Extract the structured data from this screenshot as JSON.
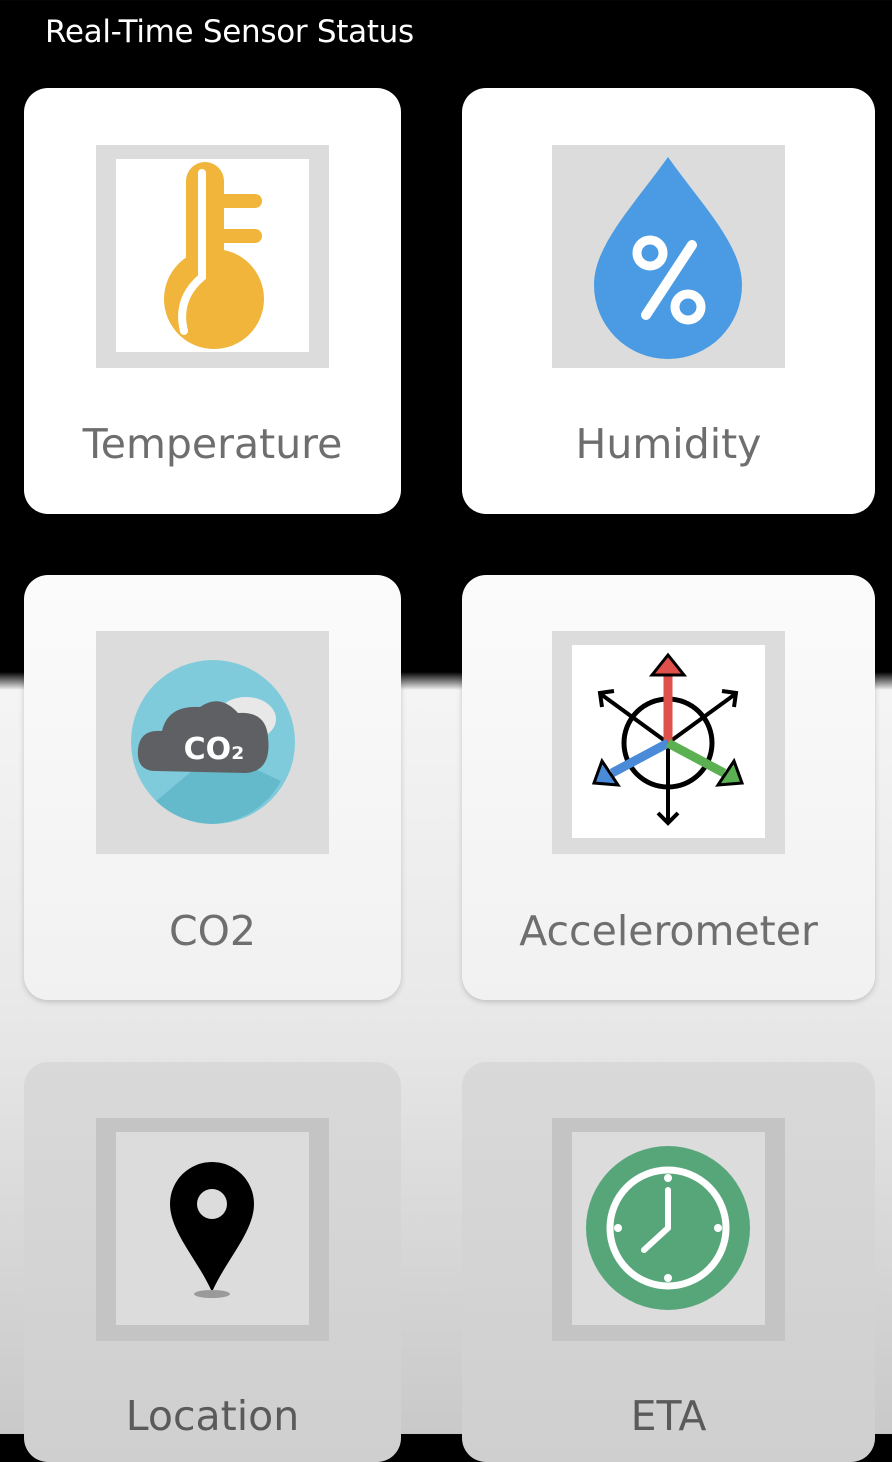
{
  "header": {
    "title": "Real-Time Sensor Status"
  },
  "sensors": [
    {
      "label": "Temperature",
      "icon": "thermometer-icon",
      "color": "#F0B53A"
    },
    {
      "label": "Humidity",
      "icon": "humidity-drop-icon",
      "color": "#4A9BE3"
    },
    {
      "label": "CO2",
      "icon": "co2-cloud-icon",
      "color": "#7FCBDC",
      "icon_text": "CO2"
    },
    {
      "label": "Accelerometer",
      "icon": "accelerometer-axes-icon",
      "color": "#E1514B"
    },
    {
      "label": "Location",
      "icon": "location-pin-icon",
      "color": "#000000"
    },
    {
      "label": "ETA",
      "icon": "clock-icon",
      "color": "#57A67A"
    }
  ]
}
